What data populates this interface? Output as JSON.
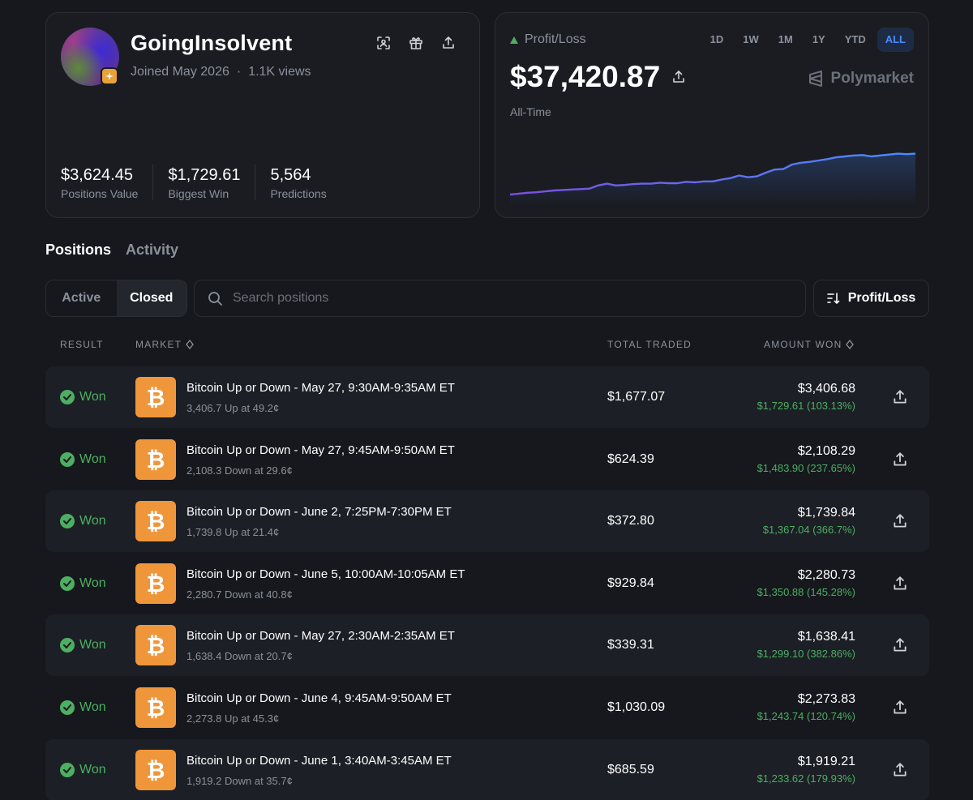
{
  "profile": {
    "username": "GoingInsolvent",
    "joined": "Joined May 2026",
    "separator": "·",
    "views": "1.1K views",
    "stats": [
      {
        "value": "$3,624.45",
        "label": "Positions Value"
      },
      {
        "value": "$1,729.61",
        "label": "Biggest Win"
      },
      {
        "value": "5,564",
        "label": "Predictions"
      }
    ]
  },
  "pnl": {
    "label": "Profit/Loss",
    "value": "$37,420.87",
    "period": "All-Time",
    "brand": "Polymarket",
    "ranges": [
      "1D",
      "1W",
      "1M",
      "1Y",
      "YTD",
      "ALL"
    ],
    "active_range": "ALL",
    "colors": {
      "line_start": "#7b4fe0",
      "line_end": "#4a8cff",
      "positive": "#4caf62"
    }
  },
  "chart_data": {
    "type": "area",
    "values": [
      0,
      0.02,
      0.04,
      0.05,
      0.07,
      0.09,
      0.1,
      0.11,
      0.12,
      0.13,
      0.2,
      0.24,
      0.2,
      0.21,
      0.23,
      0.24,
      0.24,
      0.26,
      0.25,
      0.25,
      0.28,
      0.27,
      0.29,
      0.29,
      0.33,
      0.36,
      0.42,
      0.38,
      0.4,
      0.48,
      0.55,
      0.56,
      0.66,
      0.7,
      0.72,
      0.75,
      0.78,
      0.82,
      0.84,
      0.86,
      0.87,
      0.84,
      0.86,
      0.88,
      0.9,
      0.89,
      0.9
    ]
  },
  "tabs": {
    "positions": "Positions",
    "activity": "Activity"
  },
  "filters": {
    "active": "Active",
    "closed": "Closed",
    "search_placeholder": "Search positions",
    "sort": "Profit/Loss"
  },
  "table": {
    "headers": {
      "result": "RESULT",
      "market": "MARKET",
      "total": "TOTAL TRADED",
      "amount": "AMOUNT WON"
    },
    "rows": [
      {
        "result": "Won",
        "title": "Bitcoin Up or Down - May 27, 9:30AM-9:35AM ET",
        "sub": "3,406.7 Up at 49.2¢",
        "traded": "$1,677.07",
        "amount": "$3,406.68",
        "gain": "$1,729.61 (103.13%)"
      },
      {
        "result": "Won",
        "title": "Bitcoin Up or Down - May 27, 9:45AM-9:50AM ET",
        "sub": "2,108.3 Down at 29.6¢",
        "traded": "$624.39",
        "amount": "$2,108.29",
        "gain": "$1,483.90 (237.65%)"
      },
      {
        "result": "Won",
        "title": "Bitcoin Up or Down - June 2, 7:25PM-7:30PM ET",
        "sub": "1,739.8 Up at 21.4¢",
        "traded": "$372.80",
        "amount": "$1,739.84",
        "gain": "$1,367.04 (366.7%)"
      },
      {
        "result": "Won",
        "title": "Bitcoin Up or Down - June 5, 10:00AM-10:05AM ET",
        "sub": "2,280.7 Down at 40.8¢",
        "traded": "$929.84",
        "amount": "$2,280.73",
        "gain": "$1,350.88 (145.28%)"
      },
      {
        "result": "Won",
        "title": "Bitcoin Up or Down - May 27, 2:30AM-2:35AM ET",
        "sub": "1,638.4 Down at 20.7¢",
        "traded": "$339.31",
        "amount": "$1,638.41",
        "gain": "$1,299.10 (382.86%)"
      },
      {
        "result": "Won",
        "title": "Bitcoin Up or Down - June 4, 9:45AM-9:50AM ET",
        "sub": "2,273.8 Up at 45.3¢",
        "traded": "$1,030.09",
        "amount": "$2,273.83",
        "gain": "$1,243.74 (120.74%)"
      },
      {
        "result": "Won",
        "title": "Bitcoin Up or Down - June 1, 3:40AM-3:45AM ET",
        "sub": "1,919.2 Down at 35.7¢",
        "traded": "$685.59",
        "amount": "$1,919.21",
        "gain": "$1,233.62 (179.93%)"
      }
    ]
  }
}
